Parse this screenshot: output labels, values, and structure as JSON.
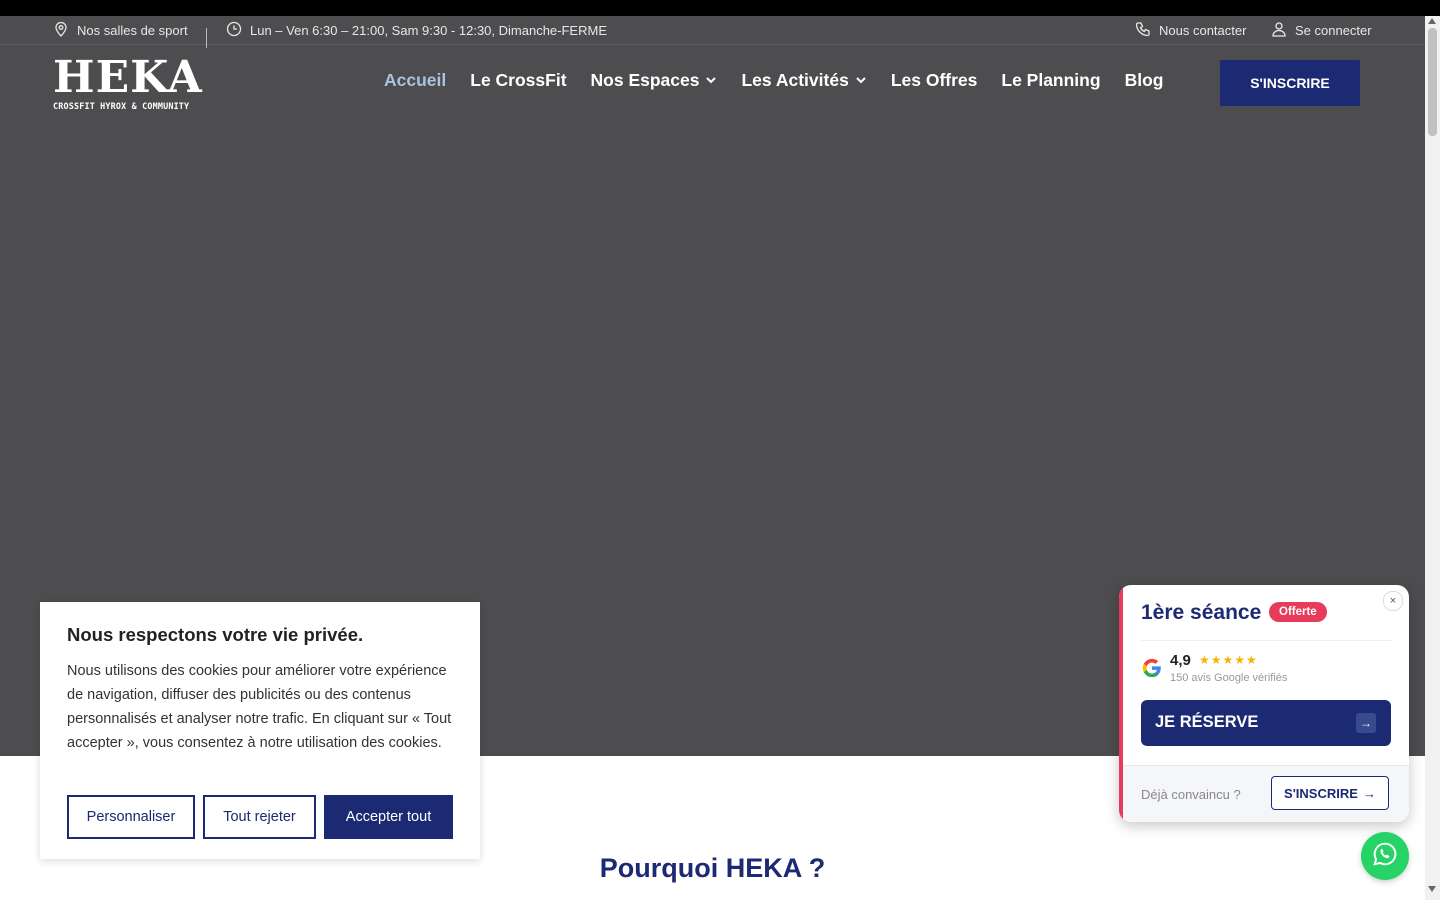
{
  "topbar": {
    "locations": "Nos salles de sport",
    "hours": "Lun – Ven 6:30 – 21:00, Sam 9:30 - 12:30, Dimanche-FERME",
    "contact": "Nous contacter",
    "login": "Se connecter"
  },
  "logo": {
    "main": "HEKA",
    "tagline": "CROSSFIT HYROX & COMMUNITY"
  },
  "nav": {
    "items": [
      {
        "label": "Accueil"
      },
      {
        "label": "Le CrossFit"
      },
      {
        "label": "Nos Espaces"
      },
      {
        "label": "Les Activités"
      },
      {
        "label": "Les Offres"
      },
      {
        "label": "Le Planning"
      },
      {
        "label": "Blog"
      }
    ],
    "cta": "S'INSCRIRE"
  },
  "section": {
    "title": "Pourquoi HEKA ?"
  },
  "cookie": {
    "title": "Nous respectons votre vie privée.",
    "text": "Nous utilisons des cookies pour améliorer votre expérience de navigation, diffuser des publicités ou des contenus personnalisés et analyser notre trafic. En cliquant sur « Tout accepter », vous consentez à notre utilisation des cookies.",
    "customize": "Personnaliser",
    "reject": "Tout rejeter",
    "accept": "Accepter tout"
  },
  "promo": {
    "title": "1ère séance",
    "badge": "Offerte",
    "close": "×",
    "rating": "4,9",
    "stars": "★★★★★",
    "reviews": "150 avis Google vérifiés",
    "reserve": "JE RÉSERVE",
    "reserve_arrow": "→",
    "already": "Déjà convaincu ?",
    "signup": "S'INSCRIRE",
    "signup_arrow": "→"
  },
  "colors": {
    "brand_navy": "#1b2a72",
    "hero_gray": "#4d4d4f",
    "accent_red": "#e63b5a",
    "whatsapp_green": "#25d366",
    "nav_active": "#a9c3e0"
  }
}
